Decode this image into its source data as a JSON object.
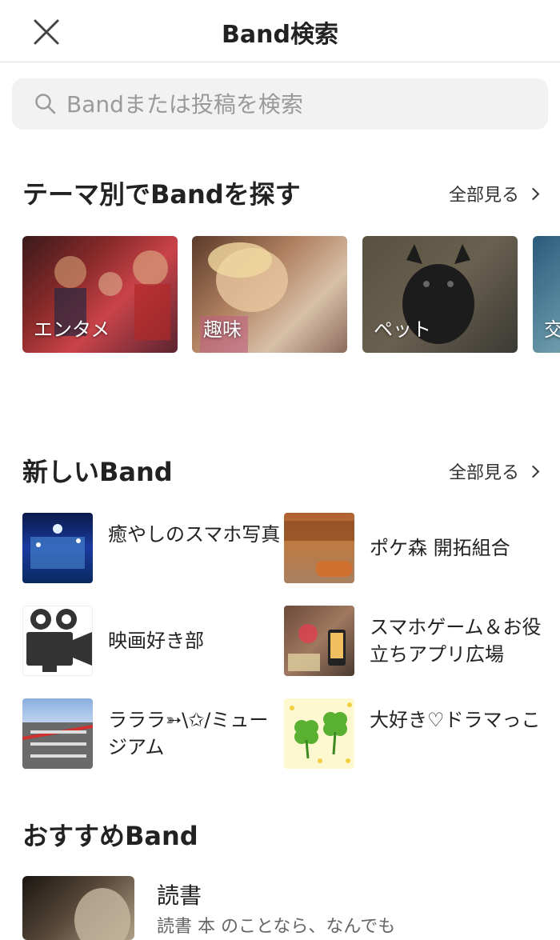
{
  "header": {
    "title": "Band検索",
    "close_icon": "close-icon"
  },
  "search": {
    "placeholder": "Bandまたは投稿を検索",
    "icon": "search-icon"
  },
  "themes": {
    "title": "テーマ別でBandを探す",
    "see_all": "全部見る",
    "items": [
      {
        "label": "エンタメ"
      },
      {
        "label": "趣味"
      },
      {
        "label": "ペット"
      },
      {
        "label": "交"
      }
    ]
  },
  "new_bands": {
    "title": "新しいBand",
    "see_all": "全部見る",
    "items": [
      {
        "name": "癒やしのスマホ写真"
      },
      {
        "name": "ポケ森 開拓組合"
      },
      {
        "name": "映画好き部"
      },
      {
        "name": "スマホゲーム＆お役立ちアプリ広場"
      },
      {
        "name": "ラララ➳\\✩/ミュージアム"
      },
      {
        "name": "大好き♡ドラマっこ"
      }
    ]
  },
  "recommended": {
    "title": "おすすめBand",
    "items": [
      {
        "name": "読書",
        "description": "読書 本 のことなら、なんでも"
      }
    ]
  }
}
